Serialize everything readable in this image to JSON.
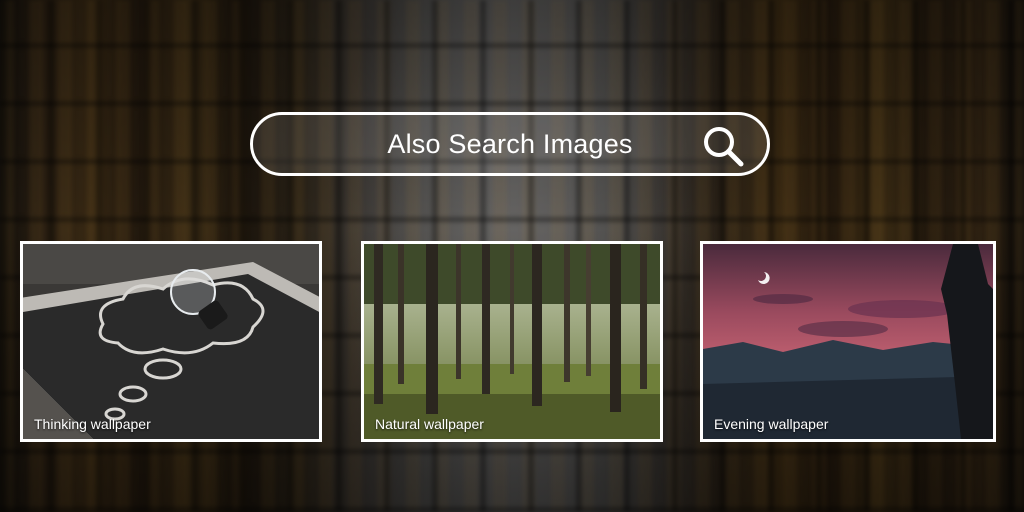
{
  "search": {
    "label": "Also Search Images",
    "icon": "search-icon"
  },
  "cards": [
    {
      "caption": "Thinking wallpaper",
      "image": "lightbulb-chalkboard"
    },
    {
      "caption": "Natural wallpaper",
      "image": "forest"
    },
    {
      "caption": "Evening wallpaper",
      "image": "evening-sky-silhouette"
    }
  ],
  "colors": {
    "border": "#ffffff",
    "text": "#ffffff"
  }
}
